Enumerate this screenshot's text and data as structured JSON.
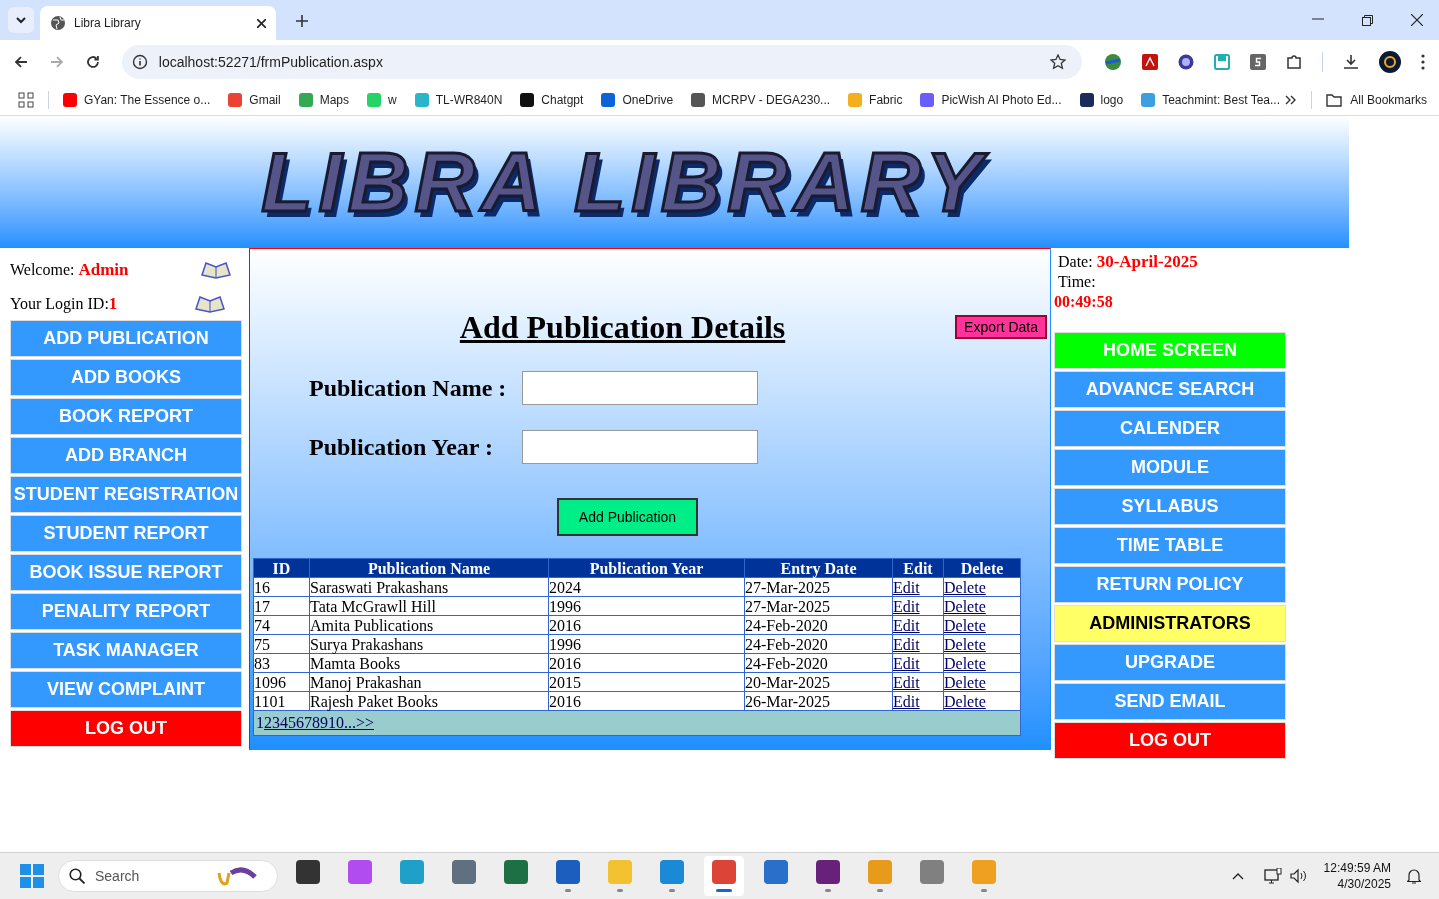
{
  "browser": {
    "tabs": [
      {
        "title": "Libra Library",
        "selected": true
      }
    ],
    "url": "localhost:52271/frmPublication.aspx",
    "bookmarks": [
      {
        "label": "GYan: The Essence o...",
        "color": "#ff0000"
      },
      {
        "label": "Gmail",
        "color": "#ea4335"
      },
      {
        "label": "Maps",
        "color": "#34a853"
      },
      {
        "label": "w",
        "color": "#25d366"
      },
      {
        "label": "TL-WR840N",
        "color": "#2bb5c9"
      },
      {
        "label": "Chatgpt",
        "color": "#111111"
      },
      {
        "label": "OneDrive",
        "color": "#0a64d8"
      },
      {
        "label": "MCRPV - DEGA230...",
        "color": "#555555"
      },
      {
        "label": "Fabric",
        "color": "#f2b01e"
      },
      {
        "label": "PicWish AI Photo Ed...",
        "color": "#6a5cff"
      },
      {
        "label": "logo",
        "color": "#1a2a5a"
      },
      {
        "label": "Teachmint: Best Tea...",
        "color": "#3ca0e0"
      }
    ],
    "all_bookmarks": "All Bookmarks"
  },
  "page": {
    "logo_text": "LIBRA LIBRARY",
    "welcome_label": "Welcome:",
    "user": "Admin",
    "login_label": "Your Login ID:",
    "login_id": "1",
    "left_menu": [
      {
        "label": "ADD PUBLICATION",
        "kind": "normal"
      },
      {
        "label": "ADD BOOKS",
        "kind": "normal"
      },
      {
        "label": "BOOK REPORT",
        "kind": "normal"
      },
      {
        "label": "ADD BRANCH",
        "kind": "normal"
      },
      {
        "label": "STUDENT REGISTRATION",
        "kind": "normal"
      },
      {
        "label": "STUDENT REPORT",
        "kind": "normal"
      },
      {
        "label": "BOOK ISSUE REPORT",
        "kind": "normal"
      },
      {
        "label": "PENALITY REPORT",
        "kind": "normal"
      },
      {
        "label": "TASK MANAGER",
        "kind": "normal"
      },
      {
        "label": "VIEW COMPLAINT",
        "kind": "normal"
      },
      {
        "label": "LOG OUT",
        "kind": "logout"
      }
    ],
    "heading": "Add Publication Details",
    "export_button": "Export Data",
    "fields": [
      {
        "label": "Publication Name :"
      },
      {
        "label": "Publication Year :"
      }
    ],
    "submit_button": "Add Publication",
    "table": {
      "columns": [
        "ID",
        "Publication Name",
        "Publication Year",
        "Entry Date",
        "Edit",
        "Delete"
      ],
      "rows": [
        [
          "16",
          "Saraswati Prakashans",
          "2024",
          "27-Mar-2025",
          "Edit",
          "Delete"
        ],
        [
          "17",
          "Tata McGrawll Hill",
          "1996",
          "27-Mar-2025",
          "Edit",
          "Delete"
        ],
        [
          "74",
          "Amita Publications",
          "2016",
          "24-Feb-2020",
          "Edit",
          "Delete"
        ],
        [
          "75",
          "Surya Prakashans",
          "1996",
          "24-Feb-2020",
          "Edit",
          "Delete"
        ],
        [
          "83",
          "Mamta Books",
          "2016",
          "24-Feb-2020",
          "Edit",
          "Delete"
        ],
        [
          "1096",
          "Manoj Prakashan",
          "2015",
          "20-Mar-2025",
          "Edit",
          "Delete"
        ],
        [
          "1101",
          "Rajesh Paket Books",
          "2016",
          "26-Mar-2025",
          "Edit",
          "Delete"
        ]
      ],
      "pager": [
        {
          "label": "1",
          "selected": true
        },
        {
          "label": "2",
          "selected": false
        },
        {
          "label": "3",
          "selected": false
        },
        {
          "label": "4",
          "selected": false
        },
        {
          "label": "5",
          "selected": false
        },
        {
          "label": "6",
          "selected": false
        },
        {
          "label": "7",
          "selected": false
        },
        {
          "label": "8",
          "selected": false
        },
        {
          "label": "9",
          "selected": false
        },
        {
          "label": "10",
          "selected": false
        },
        {
          "label": "...",
          "selected": false
        },
        {
          "label": ">>",
          "selected": false
        }
      ]
    },
    "date_label": "Date:",
    "date": "30-April-2025",
    "time_label": "Time:",
    "time": "00:49:58",
    "right_menu": [
      {
        "label": "HOME SCREEN",
        "kind": "home"
      },
      {
        "label": "ADVANCE SEARCH",
        "kind": "normal"
      },
      {
        "label": "CALENDER",
        "kind": "normal"
      },
      {
        "label": "MODULE",
        "kind": "normal"
      },
      {
        "label": "SYLLABUS",
        "kind": "normal"
      },
      {
        "label": "TIME TABLE",
        "kind": "normal"
      },
      {
        "label": "RETURN POLICY",
        "kind": "normal"
      },
      {
        "label": "ADMINISTRATORS",
        "kind": "highlight"
      },
      {
        "label": "UPGRADE",
        "kind": "normal"
      },
      {
        "label": "SEND EMAIL",
        "kind": "normal"
      },
      {
        "label": "LOG OUT",
        "kind": "logout"
      }
    ]
  },
  "taskbar": {
    "search_placeholder": "Search",
    "time": "12:49:59 AM",
    "date": "4/30/2025",
    "apps": [
      {
        "running": false,
        "selected": false,
        "color": "#333333"
      },
      {
        "running": false,
        "selected": false,
        "color": "#b04cf0"
      },
      {
        "running": false,
        "selected": false,
        "color": "#1ea0c8"
      },
      {
        "running": false,
        "selected": false,
        "color": "#607080"
      },
      {
        "running": false,
        "selected": false,
        "color": "#1d7044"
      },
      {
        "running": true,
        "selected": false,
        "color": "#1b5ebe"
      },
      {
        "running": true,
        "selected": false,
        "color": "#f2c230"
      },
      {
        "running": true,
        "selected": false,
        "color": "#1b8ad6"
      },
      {
        "running": true,
        "selected": true,
        "color": "#db4437"
      },
      {
        "running": false,
        "selected": false,
        "color": "#2a6fc9"
      },
      {
        "running": true,
        "selected": false,
        "color": "#68217a"
      },
      {
        "running": true,
        "selected": false,
        "color": "#e89a1a"
      },
      {
        "running": false,
        "selected": false,
        "color": "#808080"
      },
      {
        "running": true,
        "selected": false,
        "color": "#f0a020"
      }
    ]
  }
}
